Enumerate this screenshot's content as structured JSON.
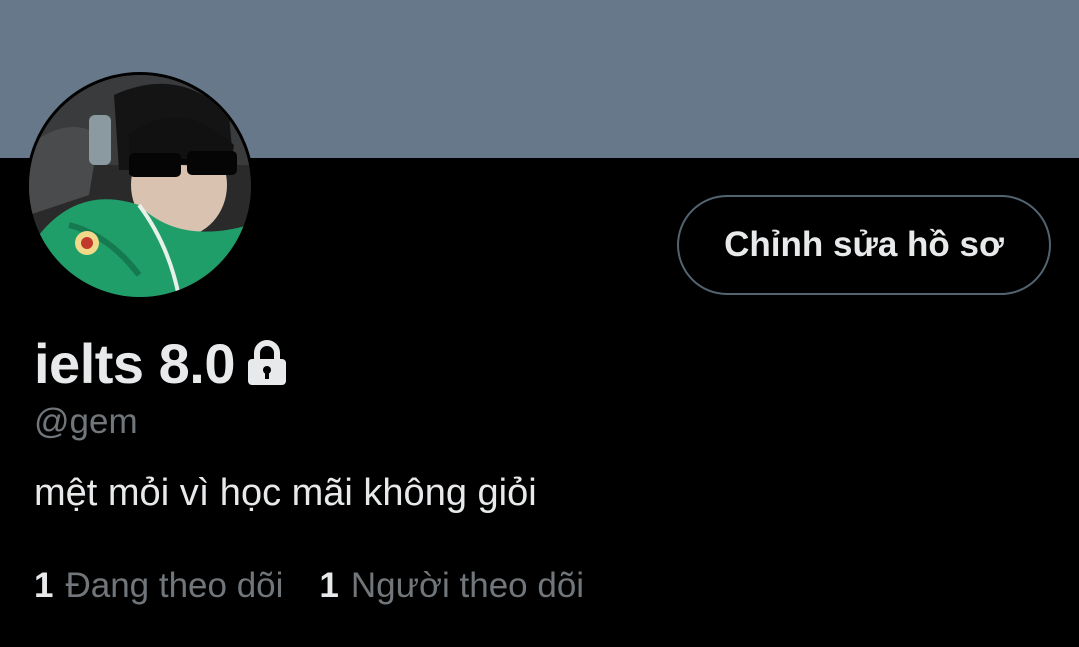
{
  "profile": {
    "banner_color": "#66788a",
    "avatar": {
      "description_icon": "profile-photo"
    },
    "edit_button_label": "Chỉnh sửa hồ sơ",
    "display_name": "ielts 8.0",
    "locked_icon": "lock-icon",
    "handle": "@gem",
    "bio": "mệt mỏi vì học mãi không giỏi",
    "stats": [
      {
        "count": "1",
        "label": "Đang theo dõi"
      },
      {
        "count": "1",
        "label": "Người theo dõi"
      }
    ]
  }
}
